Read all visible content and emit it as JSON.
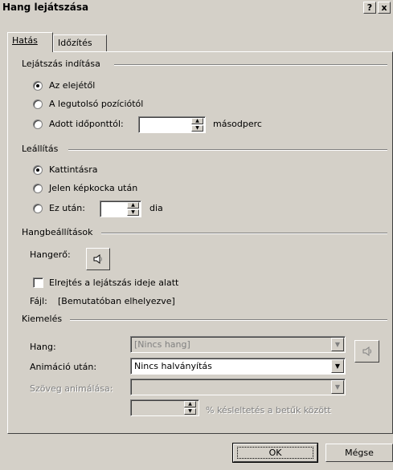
{
  "window": {
    "title": "Hang lejátszása",
    "help_label": "?",
    "close_label": "x"
  },
  "tabs": [
    {
      "label": "Hatás"
    },
    {
      "label": "Időzítés"
    }
  ],
  "start": {
    "legend": "Lejátszás indítása",
    "opt1": "Az elejétől",
    "opt2": "A legutolsó pozíciótól",
    "opt3": "Adott időponttól:",
    "seconds_value": "",
    "seconds_unit": "másodperc"
  },
  "stop": {
    "legend": "Leállítás",
    "opt1": "Kattintásra",
    "opt2": "Jelen képkocka után",
    "opt3": "Ez után:",
    "slides_value": "",
    "slides_unit": "dia"
  },
  "sound_settings": {
    "legend": "Hangbeállítások",
    "volume_label": "Hangerő:",
    "hide_label": "Elrejtés a lejátszás ideje alatt",
    "file_label": "Fájl:",
    "file_value": "[Bemutatóban elhelyezve]"
  },
  "enhancements": {
    "legend": "Kiemelés",
    "sound_label": "Hang:",
    "sound_value": "[Nincs hang]",
    "after_anim_label": "Animáció után:",
    "after_anim_value": "Nincs halványítás",
    "animate_text_label": "Szöveg animálása:",
    "animate_text_value": "",
    "delay_value": "",
    "delay_label": "% késleltetés a betűk között"
  },
  "buttons": {
    "ok": "OK",
    "cancel": "Mégse"
  }
}
